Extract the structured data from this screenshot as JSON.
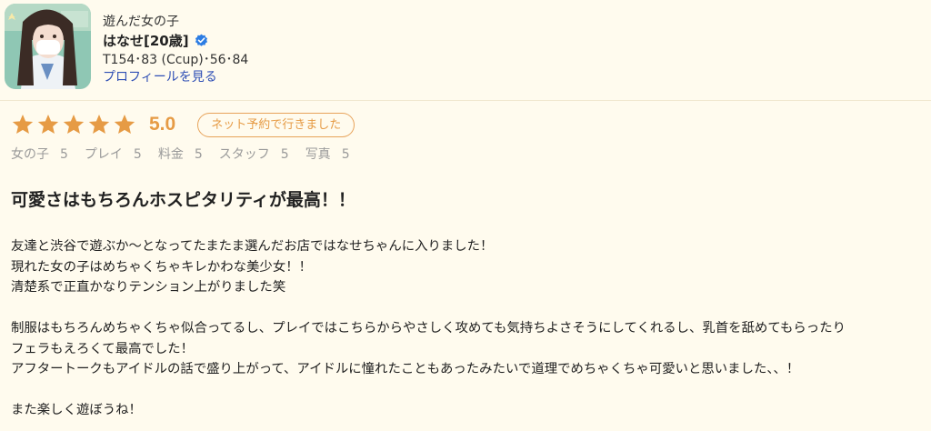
{
  "header": {
    "caption": "遊んだ女の子",
    "girl_name": "はなせ[20歳]",
    "stats": "T154･83 (Ccup)･56･84",
    "profile_link": "プロフィールを見る"
  },
  "rating": {
    "stars": 5,
    "score": "5.0",
    "tag": "ネット予約で行きました"
  },
  "sub_scores": [
    {
      "label": "女の子",
      "value": "5"
    },
    {
      "label": "プレイ",
      "value": "5"
    },
    {
      "label": "料金",
      "value": "5"
    },
    {
      "label": "スタッフ",
      "value": "5"
    },
    {
      "label": "写真",
      "value": "5"
    }
  ],
  "review": {
    "title": "可愛さはもちろんホスピタリティが最高！！",
    "line_1": "友達と渋谷で遊ぶか〜となってたまたま選んだお店ではなせちゃんに入りました！",
    "line_2": "現れた女の子はめちゃくちゃキレかわな美少女！！",
    "line_3": "清楚系で正直かなりテンション上がりました笑",
    "line_4": "制服はもちろんめちゃくちゃ似合ってるし、プレイではこちらからやさしく攻めても気持ちよさそうにしてくれるし、乳首を舐めてもらったり",
    "line_5": "フェラもえろくて最高でした！",
    "line_6": "アフタートークもアイドルの話で盛り上がって、アイドルに憧れたこともあったみたいで道理でめちゃくちゃ可愛いと思いました、、！",
    "line_7": "また楽しく遊ぼうね！"
  },
  "colors": {
    "background": "#fffbee",
    "accent": "#e69b45",
    "link": "#2f4fb5",
    "verified": "#2d7de3",
    "muted": "#9a9a9a"
  }
}
